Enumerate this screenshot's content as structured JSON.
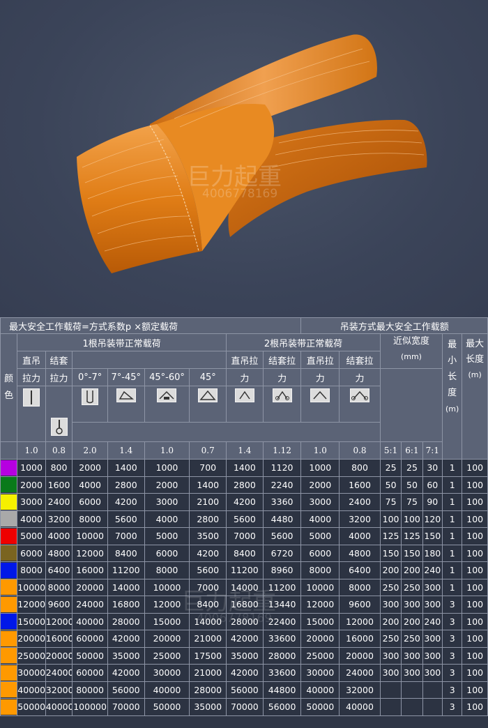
{
  "watermark": {
    "brand": "巨力起重",
    "phone": "4006778169"
  },
  "table": {
    "title_left": "最大安全工作载荷=方式系数p  ×额定载荷",
    "title_right": "吊装方式最大安全工作载额",
    "col_color": "颜色",
    "group_single": "1根吊装带正常载荷",
    "group_double": "2根吊装带正常载荷",
    "col_width": "近似宽度",
    "col_width_unit": "(mm)",
    "col_min_len": "最小长度",
    "col_min_len_unit": "(m)",
    "col_max_len": "最大长度",
    "col_max_len_unit": "(m)",
    "single_vertical_a": "直吊",
    "single_vertical_b": "拉力",
    "single_choke_a": "结套",
    "single_choke_b": "拉力",
    "angle_0_7": "0°-7°",
    "angle_7_45": "7°-45°",
    "angle_45_60": "45°-60°",
    "angle_45": "45°",
    "double_vertical_a": "直吊拉",
    "double_vertical_b": "力",
    "double_choke_a": "结套拉",
    "double_choke_b": "力",
    "double_vertical2_a": "直吊拉",
    "double_vertical2_b": "力",
    "double_choke2_a": "结套拉",
    "double_choke2_b": "力",
    "coef": [
      "1.0",
      "0.8",
      "2.0",
      "1.4",
      "1.0",
      "0.7",
      "1.4",
      "1.12",
      "1.0",
      "0.8"
    ],
    "ratio_a": "5:1",
    "ratio_b": "6:1",
    "ratio_c": "7:1",
    "rows": [
      {
        "color": "#b600e0",
        "v": [
          "1000",
          "800",
          "2000",
          "1400",
          "1000",
          "700",
          "1400",
          "1120",
          "1000",
          "800"
        ],
        "w": [
          "25",
          "25",
          "30"
        ],
        "min": "1",
        "max": "100"
      },
      {
        "color": "#0a7a1a",
        "v": [
          "2000",
          "1600",
          "4000",
          "2800",
          "2000",
          "1400",
          "2800",
          "2240",
          "2000",
          "1600"
        ],
        "w": [
          "50",
          "50",
          "60"
        ],
        "min": "1",
        "max": "100"
      },
      {
        "color": "#f5f000",
        "v": [
          "3000",
          "2400",
          "6000",
          "4200",
          "3000",
          "2100",
          "4200",
          "3360",
          "3000",
          "2400"
        ],
        "w": [
          "75",
          "75",
          "90"
        ],
        "min": "1",
        "max": "100"
      },
      {
        "color": "#a9a9a9",
        "v": [
          "4000",
          "3200",
          "8000",
          "5600",
          "4000",
          "2800",
          "5600",
          "4480",
          "4000",
          "3200"
        ],
        "w": [
          "100",
          "100",
          "120"
        ],
        "min": "1",
        "max": "100"
      },
      {
        "color": "#ee0000",
        "v": [
          "5000",
          "4000",
          "10000",
          "7000",
          "5000",
          "3500",
          "7000",
          "5600",
          "5000",
          "4000"
        ],
        "w": [
          "125",
          "125",
          "150"
        ],
        "min": "1",
        "max": "100"
      },
      {
        "color": "#7a6420",
        "v": [
          "6000",
          "4800",
          "12000",
          "8400",
          "6000",
          "4200",
          "8400",
          "6720",
          "6000",
          "4800"
        ],
        "w": [
          "150",
          "150",
          "180"
        ],
        "min": "1",
        "max": "100"
      },
      {
        "color": "#0018e8",
        "v": [
          "8000",
          "6400",
          "16000",
          "11200",
          "8000",
          "5600",
          "11200",
          "8960",
          "8000",
          "6400"
        ],
        "w": [
          "200",
          "200",
          "240"
        ],
        "min": "1",
        "max": "100"
      },
      {
        "color": "#ff9900",
        "v": [
          "10000",
          "8000",
          "20000",
          "14000",
          "10000",
          "7000",
          "14000",
          "11200",
          "10000",
          "8000"
        ],
        "w": [
          "250",
          "250",
          "300"
        ],
        "min": "1",
        "max": "100"
      },
      {
        "color": "#ff9900",
        "v": [
          "12000",
          "9600",
          "24000",
          "16800",
          "12000",
          "8400",
          "16800",
          "13440",
          "12000",
          "9600"
        ],
        "w": [
          "300",
          "300",
          "300"
        ],
        "min": "3",
        "max": "100"
      },
      {
        "color": "#0018e8",
        "v": [
          "15000",
          "12000",
          "40000",
          "28000",
          "15000",
          "14000",
          "28000",
          "22400",
          "15000",
          "12000"
        ],
        "w": [
          "200",
          "200",
          "240"
        ],
        "min": "3",
        "max": "100"
      },
      {
        "color": "#ff9900",
        "v": [
          "20000",
          "16000",
          "60000",
          "42000",
          "20000",
          "21000",
          "42000",
          "33600",
          "20000",
          "16000"
        ],
        "w": [
          "250",
          "250",
          "300"
        ],
        "min": "3",
        "max": "100"
      },
      {
        "color": "#ff9900",
        "v": [
          "25000",
          "20000",
          "50000",
          "35000",
          "25000",
          "17500",
          "35000",
          "28000",
          "25000",
          "20000"
        ],
        "w": [
          "300",
          "300",
          "300"
        ],
        "min": "3",
        "max": "100"
      },
      {
        "color": "#ff9900",
        "v": [
          "30000",
          "24000",
          "60000",
          "42000",
          "30000",
          "21000",
          "42000",
          "33600",
          "30000",
          "24000"
        ],
        "w": [
          "300",
          "300",
          "300"
        ],
        "min": "3",
        "max": "100"
      },
      {
        "color": "#ff9900",
        "v": [
          "40000",
          "32000",
          "80000",
          "56000",
          "40000",
          "28000",
          "56000",
          "44800",
          "40000",
          "32000"
        ],
        "w": [
          "",
          "",
          ""
        ],
        "min": "3",
        "max": "100"
      },
      {
        "color": "#ff9900",
        "v": [
          "50000",
          "40000",
          "100000",
          "70000",
          "50000",
          "35000",
          "70000",
          "56000",
          "50000",
          "40000"
        ],
        "w": [
          "",
          "",
          ""
        ],
        "min": "3",
        "max": "100"
      }
    ]
  }
}
